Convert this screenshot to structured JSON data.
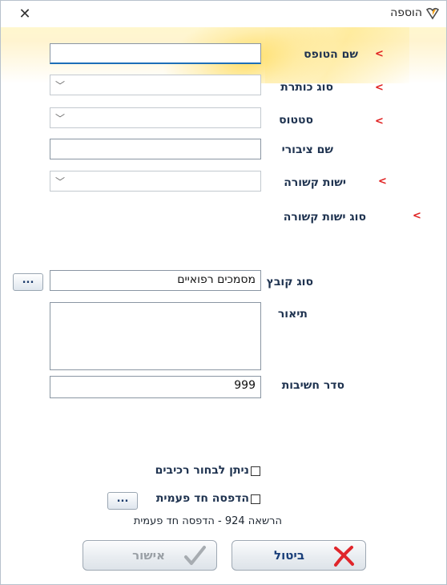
{
  "window": {
    "title": "הוספה"
  },
  "form": {
    "fields": {
      "form_name": {
        "label": "שם הטופס",
        "value": ""
      },
      "title_type": {
        "label": "סוג כותרת",
        "value": ""
      },
      "status": {
        "label": "סטטוס",
        "value": ""
      },
      "public_name": {
        "label": "שם ציבורי",
        "value": ""
      },
      "related_entity": {
        "label": "ישות קשורה",
        "value": ""
      },
      "related_entity_type": {
        "label": "סוג ישות קשורה"
      },
      "file_type": {
        "label": "סוג קובץ",
        "value": "מסמכים רפואיים",
        "browse_label": "..."
      },
      "description": {
        "label": "תיאור",
        "value": ""
      },
      "importance_order": {
        "label": "סדר חשיבות",
        "value": "999"
      }
    },
    "required_marker": "<",
    "checkboxes": {
      "allow_components": {
        "label": "ניתן לבחור רכיבים",
        "checked": false
      },
      "print_once": {
        "label": "הדפסה חד פעמית",
        "checked": false,
        "browse_label": "..."
      }
    },
    "permission_note": "הרשאה 924 - הדפסה חד פעמית"
  },
  "buttons": {
    "cancel": {
      "label": "ביטול",
      "icon": "x-icon",
      "color": "#1a3f7a",
      "icon_color": "#e0262b"
    },
    "ok": {
      "label": "אישור",
      "icon": "check-icon",
      "color": "#9aa0a6",
      "disabled": true
    }
  },
  "colors": {
    "required": "#e02020",
    "label": "#1f3350",
    "banner": "#ffd640"
  }
}
